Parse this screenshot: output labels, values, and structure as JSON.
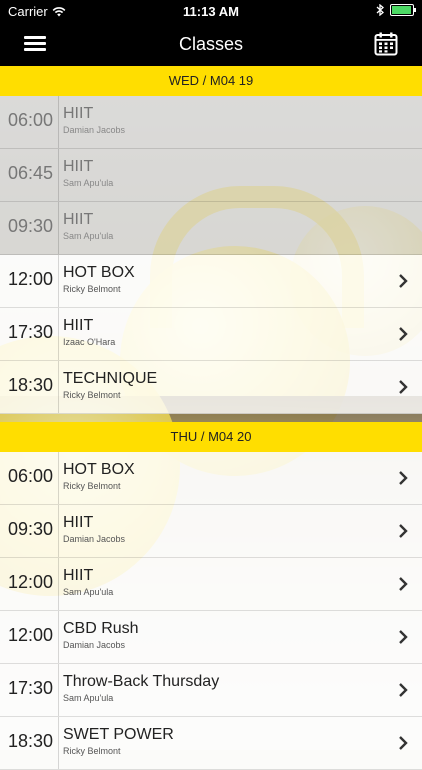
{
  "status_bar": {
    "carrier": "Carrier",
    "time": "11:13 AM"
  },
  "header": {
    "title": "Classes",
    "menu_icon": "hamburger-menu-icon",
    "calendar_icon": "calendar-icon"
  },
  "colors": {
    "accent": "#ffde00",
    "bar": "#000000"
  },
  "days": [
    {
      "label": "WED / M04 19",
      "classes": [
        {
          "time": "06:00",
          "name": "HIIT",
          "coach": "Damian Jacobs",
          "past": true
        },
        {
          "time": "06:45",
          "name": "HIIT",
          "coach": "Sam Apu'ula",
          "past": true
        },
        {
          "time": "09:30",
          "name": "HIIT",
          "coach": "Sam Apu'ula",
          "past": true
        },
        {
          "time": "12:00",
          "name": "HOT BOX",
          "coach": "Ricky Belmont",
          "past": false
        },
        {
          "time": "17:30",
          "name": "HIIT",
          "coach": "Izaac O'Hara",
          "past": false
        },
        {
          "time": "18:30",
          "name": "TECHNIQUE",
          "coach": "Ricky Belmont",
          "past": false
        }
      ]
    },
    {
      "label": "THU / M04 20",
      "classes": [
        {
          "time": "06:00",
          "name": "HOT BOX",
          "coach": "Ricky Belmont",
          "past": false
        },
        {
          "time": "09:30",
          "name": "HIIT",
          "coach": "Damian Jacobs",
          "past": false
        },
        {
          "time": "12:00",
          "name": "HIIT",
          "coach": "Sam Apu'ula",
          "past": false
        },
        {
          "time": "12:00",
          "name": "CBD Rush",
          "coach": "Damian Jacobs",
          "past": false
        },
        {
          "time": "17:30",
          "name": "Throw-Back Thursday",
          "coach": "Sam Apu'ula",
          "past": false
        },
        {
          "time": "18:30",
          "name": "SWET POWER",
          "coach": "Ricky Belmont",
          "past": false
        }
      ]
    }
  ]
}
